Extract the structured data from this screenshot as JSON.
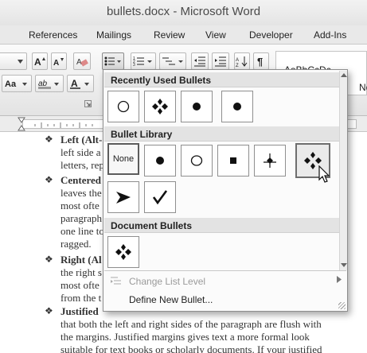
{
  "window": {
    "title": "bullets.docx - Microsoft Word"
  },
  "ribbon": {
    "tabs": [
      "References",
      "Mailings",
      "Review",
      "View",
      "Developer",
      "Add-Ins"
    ],
    "style_preview": {
      "top": "AaBbCcDc",
      "bottom": "No"
    }
  },
  "document": {
    "lines": [
      {
        "bullet": true,
        "bold": "Left (Alt-",
        "text": ""
      },
      {
        "bullet": false,
        "bold": "",
        "text": "left side a"
      },
      {
        "bullet": false,
        "bold": "",
        "text": "letters, rep"
      },
      {
        "bullet": true,
        "bold": "Centered",
        "text": ""
      },
      {
        "bullet": false,
        "bold": "",
        "text": "leaves the"
      },
      {
        "bullet": false,
        "bold": "",
        "text": "most ofte"
      },
      {
        "bullet": false,
        "bold": "",
        "text": "paragraph"
      },
      {
        "bullet": false,
        "bold": "",
        "text": "one line to"
      },
      {
        "bullet": false,
        "bold": "",
        "text": "ragged."
      },
      {
        "bullet": true,
        "bold": "Right (Al",
        "text": ""
      },
      {
        "bullet": false,
        "bold": "",
        "text": "the right s"
      },
      {
        "bullet": false,
        "bold": "",
        "text": "most ofte"
      },
      {
        "bullet": false,
        "bold": "",
        "text": "from the t"
      },
      {
        "bullet": true,
        "bold": "Justified",
        "text": ""
      },
      {
        "bullet": false,
        "bold": "",
        "text": "that both the left and right sides of the paragraph are flush with"
      },
      {
        "bullet": false,
        "bold": "",
        "text": "the margins. Justified margins gives text a more formal look"
      },
      {
        "bullet": false,
        "bold": "",
        "text": "suitable for text books or scholarly documents. If your justified"
      }
    ]
  },
  "bullet_menu": {
    "recent_title": "Recently Used Bullets",
    "library_title": "Bullet Library",
    "document_title": "Document Bullets",
    "none_label": "None",
    "recent": [
      "hollow-circle",
      "four-diamond",
      "filled-circle",
      "filled-circle"
    ],
    "library": [
      "none",
      "filled-circle",
      "hollow-circle",
      "filled-square",
      "cross-diamond",
      "four-diamond",
      "arrowhead",
      "checkmark"
    ],
    "document": [
      "four-diamond"
    ],
    "change_level": "Change List Level",
    "define_new": "Define New Bullet..."
  }
}
